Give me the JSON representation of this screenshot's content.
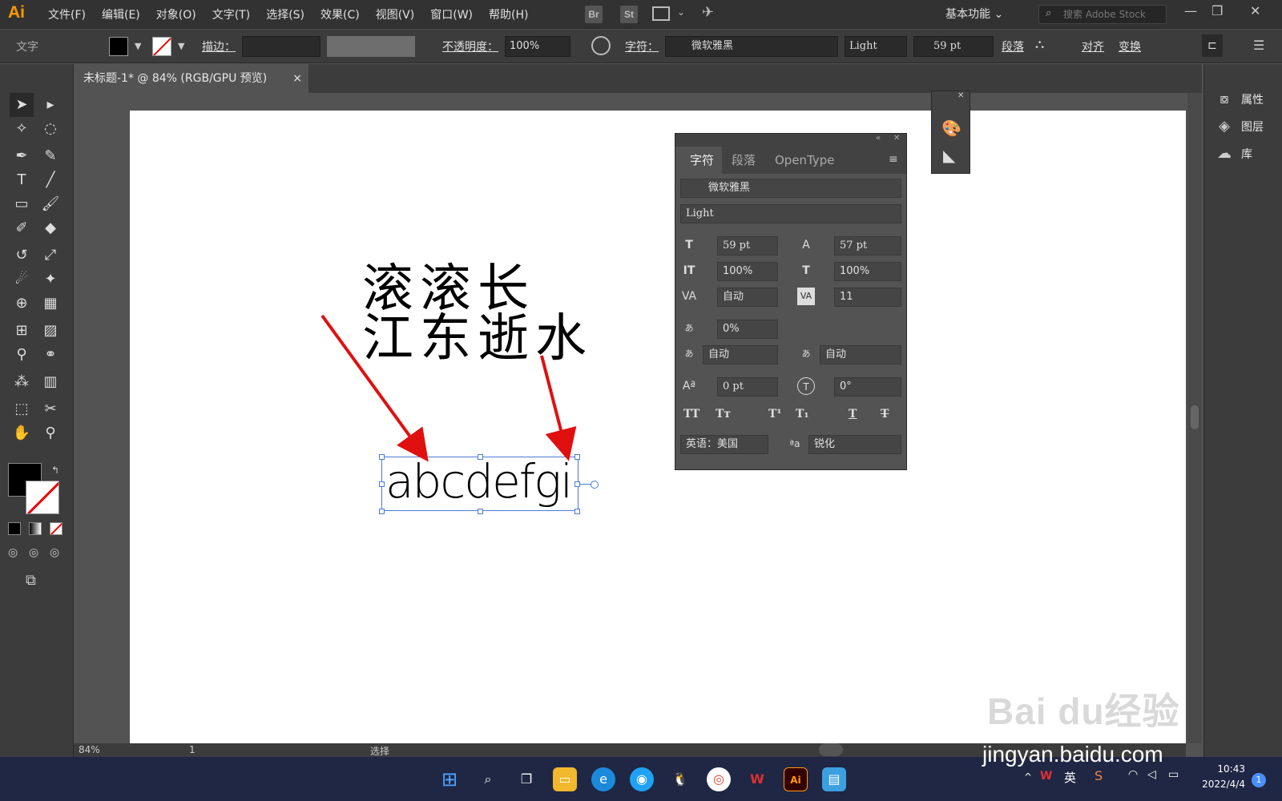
{
  "app": {
    "logo": "Ai",
    "bridge": "Br",
    "stock": "St",
    "workspace": "基本功能",
    "search_placeholder": "搜索 Adobe Stock"
  },
  "menu": [
    "文件(F)",
    "编辑(E)",
    "对象(O)",
    "文字(T)",
    "选择(S)",
    "效果(C)",
    "视图(V)",
    "窗口(W)",
    "帮助(H)"
  ],
  "control": {
    "tool_name": "文字",
    "stroke_label": "描边：",
    "opacity_label": "不透明度：",
    "opacity": "100%",
    "char_label": "字符：",
    "font": "微软雅黑",
    "style": "Light",
    "size": "59 pt",
    "para": "段落",
    "align": "对齐",
    "transform": "变换"
  },
  "tab": {
    "title": "未标题-1* @ 84% (RGB/GPU 预览)",
    "close": "×"
  },
  "canvas": {
    "line1": "滚滚长",
    "line2": "江东逝水",
    "selected_text": "abcdefgi"
  },
  "char_panel": {
    "tabs": [
      "字符",
      "段落",
      "OpenType"
    ],
    "font": "微软雅黑",
    "style": "Light",
    "size": "59 pt",
    "leading": "57 pt",
    "vscale": "100%",
    "hscale": "100%",
    "kerning": "自动",
    "tracking": "11",
    "tsume": "0%",
    "aki_left": "自动",
    "aki_right": "自动",
    "baseline": "0 pt",
    "rotate": "0°",
    "language": "英语：美国",
    "antialias": "锐化",
    "style_buttons": [
      "TT",
      "Tт",
      "T¹",
      "T₁",
      "T",
      "T"
    ]
  },
  "dock": {
    "items": [
      "属性",
      "图层",
      "库"
    ]
  },
  "status": {
    "zoom": "84%",
    "page": "1",
    "mode": "选择"
  },
  "taskbar": {
    "time": "10:43",
    "date": "2022/4/4",
    "ime": "英",
    "badge": "1"
  },
  "watermark": {
    "line1": "Bai du经验",
    "line2": "jingyan.baidu.com"
  }
}
